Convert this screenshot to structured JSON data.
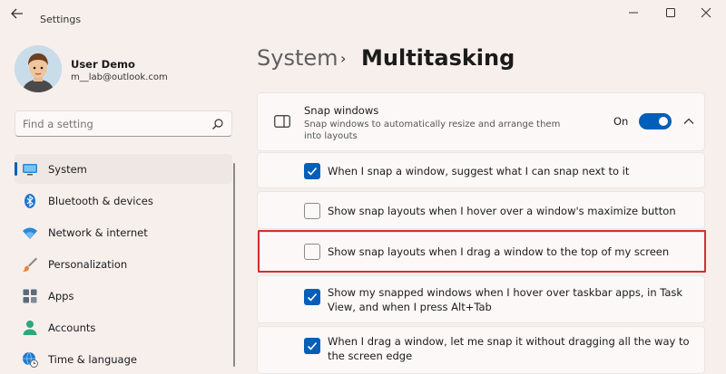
{
  "window": {
    "title": "Settings",
    "controls": {
      "minimize": "–",
      "maximize": "□",
      "close": "✕"
    }
  },
  "user": {
    "name": "User Demo",
    "email": "m__lab@outlook.com"
  },
  "search": {
    "placeholder": "Find a setting"
  },
  "sidebar": {
    "items": [
      {
        "label": "System",
        "icon": "monitor-icon",
        "active": true
      },
      {
        "label": "Bluetooth & devices",
        "icon": "bluetooth-icon"
      },
      {
        "label": "Network & internet",
        "icon": "wifi-icon"
      },
      {
        "label": "Personalization",
        "icon": "brush-icon"
      },
      {
        "label": "Apps",
        "icon": "apps-icon"
      },
      {
        "label": "Accounts",
        "icon": "person-icon"
      },
      {
        "label": "Time & language",
        "icon": "globe-clock-icon"
      }
    ]
  },
  "breadcrumb": {
    "parent": "System",
    "separator": "›",
    "current": "Multitasking"
  },
  "snap": {
    "title": "Snap windows",
    "description": "Snap windows to automatically resize and arrange them into layouts",
    "toggle_label": "On",
    "toggle_on": true
  },
  "options": [
    {
      "label": "When I snap a window, suggest what I can snap next to it",
      "checked": true
    },
    {
      "label": "Show snap layouts when I hover over a window's maximize button",
      "checked": false
    },
    {
      "label": "Show snap layouts when I drag a window to the top of my screen",
      "checked": false,
      "highlighted": true
    },
    {
      "label": "Show my snapped windows when I hover over taskbar apps, in Task View, and when I press Alt+Tab",
      "checked": true
    },
    {
      "label": "When I drag a window, let me snap it without dragging all the way to the screen edge",
      "checked": true
    }
  ],
  "colors": {
    "accent": "#005fb8",
    "background": "#f7efec",
    "highlight_border": "#d32f2f"
  }
}
